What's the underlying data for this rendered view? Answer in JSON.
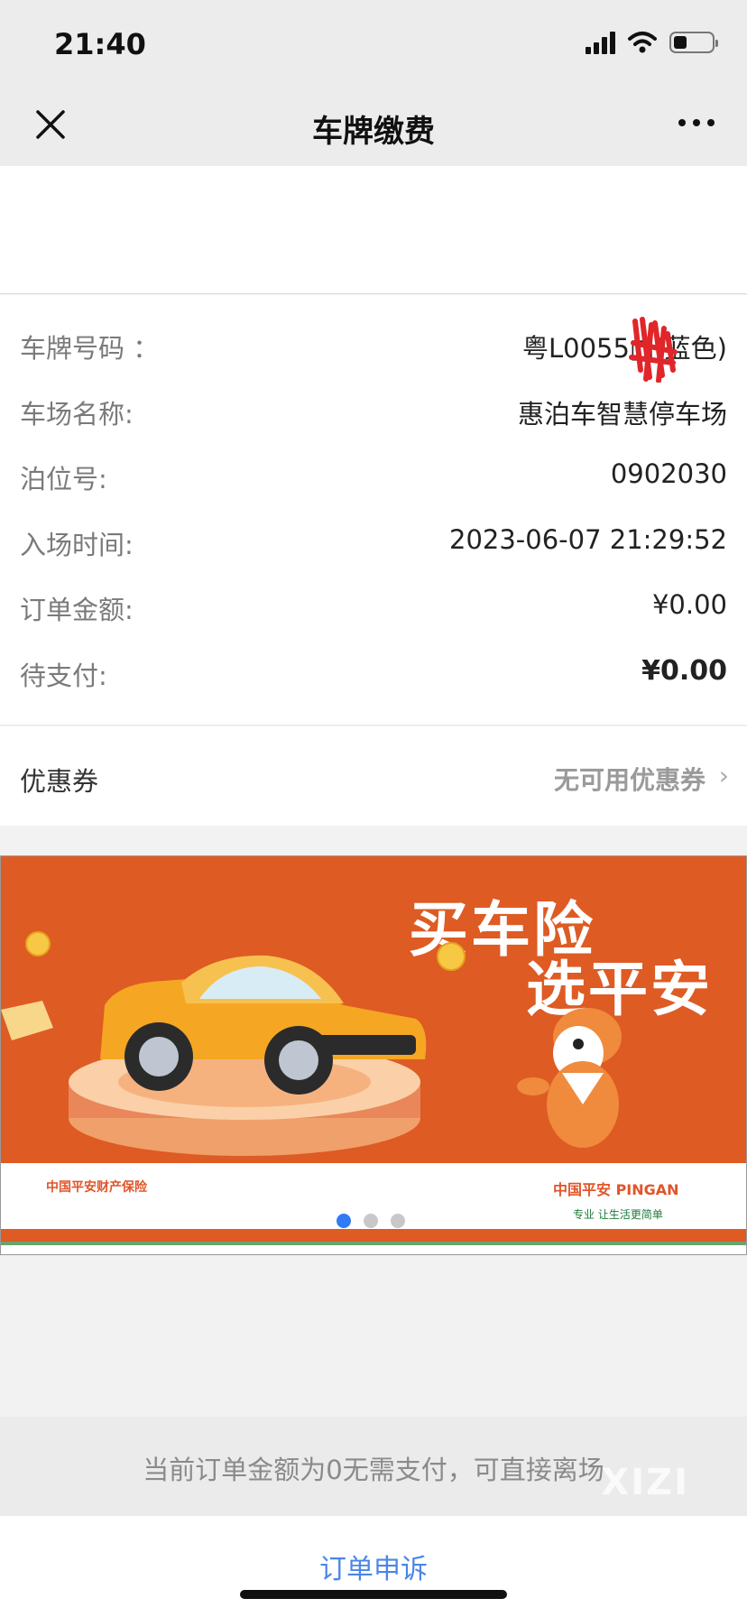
{
  "status_bar": {
    "time": "21:40"
  },
  "nav": {
    "title": "车牌缴费"
  },
  "info": {
    "rows": [
      {
        "label": "车牌号码 ：",
        "value": "粤L0055□(蓝色)"
      },
      {
        "label": "车场名称:",
        "value": "惠泊车智慧停车场"
      },
      {
        "label": "泊位号:",
        "value": "0902030"
      },
      {
        "label": "入场时间:",
        "value": "2023-06-07 21:29:52"
      },
      {
        "label": "订单金额:",
        "value": "¥0.00"
      },
      {
        "label": "待支付:",
        "value": "¥0.00"
      }
    ]
  },
  "coupon": {
    "label": "优惠券",
    "value": "无可用优惠券"
  },
  "banner": {
    "slogan_line1": "买车险",
    "slogan_line2": "选平安",
    "company": "中国平安财产保险",
    "brand": "中国平安 PINGAN",
    "tagline": "专业 让生活更简单",
    "slides": 3,
    "active_slide": 1
  },
  "notice": {
    "text": "当前订单金额为0无需支付，可直接离场"
  },
  "watermark": "XIZI",
  "appeal": {
    "label": "订单申诉"
  },
  "colors": {
    "banner_orange": "#de5b24",
    "link_blue": "#4a86e8"
  }
}
